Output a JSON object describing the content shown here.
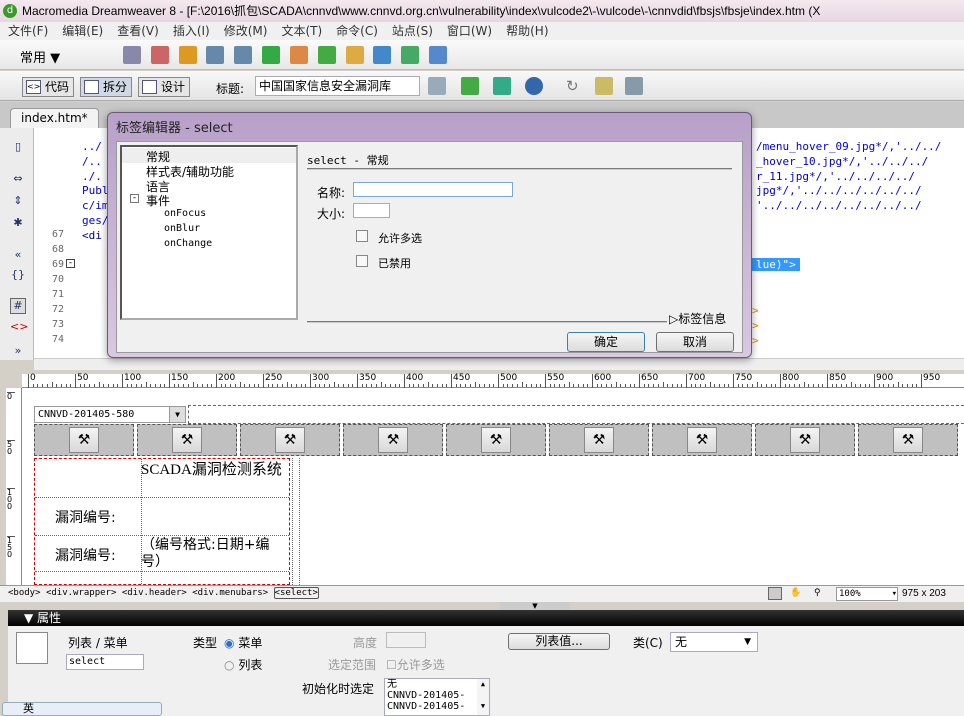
{
  "window": {
    "title": "Macromedia Dreamweaver 8 - [F:\\2016\\抓包\\SCADA\\cnnvd\\www.cnnvd.org.cn\\vulnerability\\index\\vulcode2\\-\\vulcode\\-\\cnnvdid\\fbsjs\\fbsje\\index.htm (X"
  },
  "menu": [
    "文件(F)",
    "编辑(E)",
    "查看(V)",
    "插入(I)",
    "修改(M)",
    "文本(T)",
    "命令(C)",
    "站点(S)",
    "窗口(W)",
    "帮助(H)"
  ],
  "insert_bar": {
    "category": "常用"
  },
  "doc_toolbar": {
    "code": "代码",
    "split": "拆分",
    "design": "设计",
    "title_label": "标题:",
    "title_value": "中国国家信息安全漏洞库"
  },
  "tab": {
    "label": "index.htm*"
  },
  "code": {
    "line_numbers": [
      "67",
      "68",
      "69",
      "70",
      "71",
      "72",
      "73",
      "74"
    ],
    "left_fragments": [
      "../",
      "/..",
      "./.",
      "Publ",
      "c/im",
      "ges/",
      " <di"
    ],
    "right_fragments": [
      "/menu_hover_09.jpg*/,'../../",
      "_hover_10.jpg*/,'../../../",
      "r_11.jpg*/,'../../../../",
      "jpg*/,'../../../../../../",
      "'../../../../../../../../"
    ],
    "selected_fragment": "lue)\">"
  },
  "dialog": {
    "title": "标签编辑器 - select",
    "tree": [
      "常规",
      "样式表/辅助功能",
      "语言",
      "事件",
      "onFocus",
      "onBlur",
      "onChange"
    ],
    "section_title": "select - 常规",
    "name_label": "名称:",
    "name_value": "",
    "size_label": "大小:",
    "size_value": "",
    "multiple_label": "允许多选",
    "disabled_label": "已禁用",
    "tag_info": "标签信息",
    "ok": "确定",
    "cancel": "取消"
  },
  "ruler": [
    "0",
    "50",
    "100",
    "150",
    "200",
    "250",
    "300",
    "350",
    "400",
    "450",
    "500",
    "550",
    "600",
    "650",
    "700",
    "750",
    "800",
    "850",
    "900",
    "950"
  ],
  "vruler": [
    "0",
    "50",
    "100",
    "150"
  ],
  "design": {
    "select_value": "CNNVD-201405-580",
    "heading": "SCADA漏洞检测系统",
    "row1_label": "漏洞编号:",
    "row2_label": "漏洞编号:",
    "row2_hint": "（编号格式:日期+编号）"
  },
  "status": {
    "tags": [
      "<body>",
      "<div.wrapper>",
      "<div.header>",
      "<div.menubars>",
      "<select>"
    ],
    "zoom": "100%",
    "size": "975 x 203"
  },
  "properties": {
    "header": "属性",
    "type_name": "列表 / 菜单",
    "id_value": "select",
    "type_label": "类型",
    "menu_option": "菜单",
    "list_option": "列表",
    "height_label": "高度",
    "selection_label": "选定范围",
    "allow_multiple": "允许多选",
    "list_values": "列表值...",
    "class_label": "类(C)",
    "class_value": "无",
    "initial_label": "初始化时选定",
    "initial_options": [
      "无",
      "CNNVD-201405-",
      "CNNVD-201405-"
    ]
  },
  "taskbar": {
    "ime": "英"
  }
}
